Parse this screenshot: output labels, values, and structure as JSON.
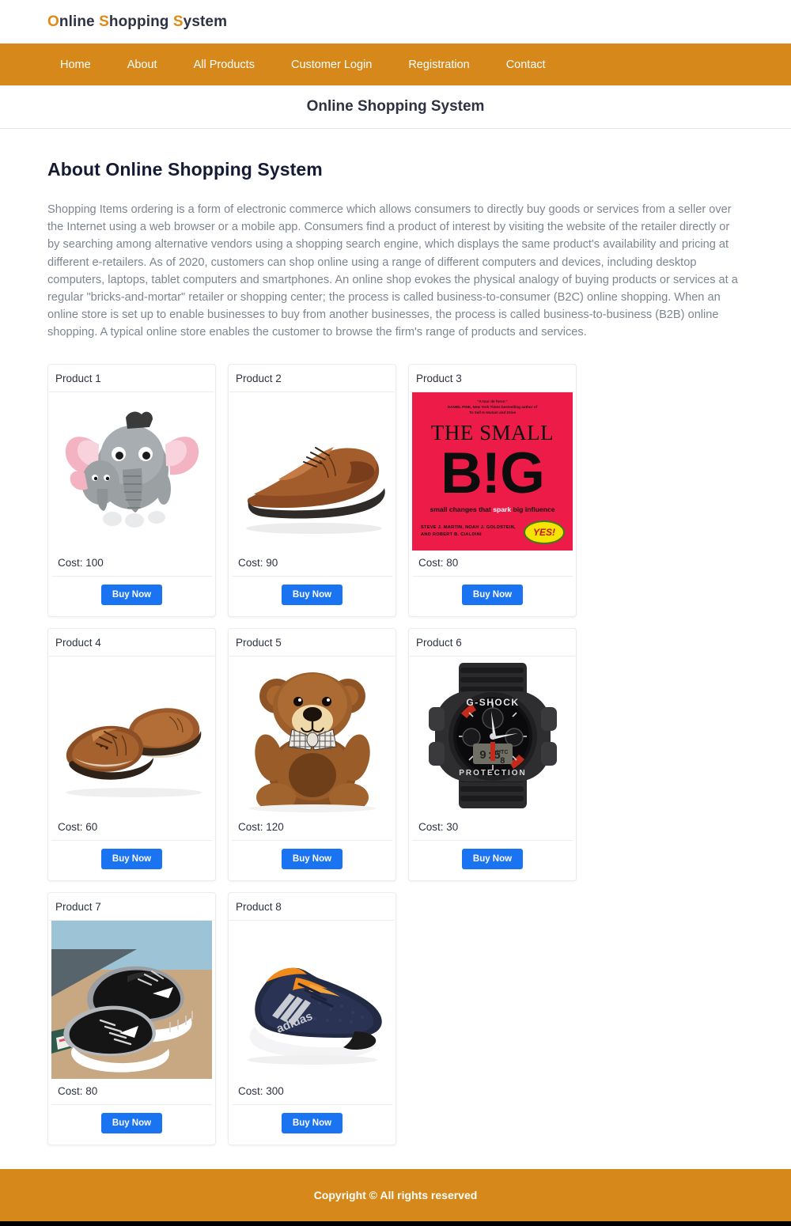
{
  "brand": {
    "parts": [
      {
        "t": "O",
        "hl": true
      },
      {
        "t": "nline ",
        "hl": false
      },
      {
        "t": "S",
        "hl": true
      },
      {
        "t": "hopping ",
        "hl": false
      },
      {
        "t": "S",
        "hl": true
      },
      {
        "t": "ystem",
        "hl": false
      }
    ],
    "full_text": "Online Shopping System"
  },
  "nav": {
    "items": [
      {
        "label": "Home"
      },
      {
        "label": "About"
      },
      {
        "label": "All Products"
      },
      {
        "label": "Customer Login"
      },
      {
        "label": "Registration"
      },
      {
        "label": "Contact"
      }
    ]
  },
  "page": {
    "title": "Online Shopping System",
    "section_title": "About Online Shopping System",
    "about_text": "Shopping Items ordering is a form of electronic commerce which allows consumers to directly buy goods or services from a seller over the Internet using a web browser or a mobile app. Consumers find a product of interest by visiting the website of the retailer directly or by searching among alternative vendors using a shopping search engine, which displays the same product's availability and pricing at different e-retailers. As of 2020, customers can shop online using a range of different computers and devices, including desktop computers, laptops, tablet computers and smartphones. An online shop evokes the physical analogy of buying products or services at a regular \"bricks-and-mortar\" retailer or shopping center; the process is called business-to-consumer (B2C) online shopping. When an online store is set up to enable businesses to buy from another businesses, the process is called business-to-business (B2B) online shopping. A typical online store enables the customer to browse the firm's range of products and services."
  },
  "products": [
    {
      "title": "Product 1",
      "cost": "Cost: 100",
      "buy_label": "Buy Now",
      "image": "elephant-plush-toy-image"
    },
    {
      "title": "Product 2",
      "cost": "Cost: 90",
      "buy_label": "Buy Now",
      "image": "brown-dress-shoe-image"
    },
    {
      "title": "Product 3",
      "cost": "Cost: 80",
      "buy_label": "Buy Now",
      "image": "the-small-big-book-cover-image"
    },
    {
      "title": "Product 4",
      "cost": "Cost: 60",
      "buy_label": "Buy Now",
      "image": "brown-brogue-shoes-pair-image"
    },
    {
      "title": "Product 5",
      "cost": "Cost: 120",
      "buy_label": "Buy Now",
      "image": "brown-teddy-bear-image"
    },
    {
      "title": "Product 6",
      "cost": "Cost: 30",
      "buy_label": "Buy Now",
      "image": "g-shock-watch-image"
    },
    {
      "title": "Product 7",
      "cost": "Cost: 80",
      "buy_label": "Buy Now",
      "image": "black-reebok-sneakers-image"
    },
    {
      "title": "Product 8",
      "cost": "Cost: 300",
      "buy_label": "Buy Now",
      "image": "navy-adidas-sneaker-image"
    }
  ],
  "book_cover": {
    "blurb_quote": "\"A tour de force.\"",
    "blurb_line2": "DANIEL PINK, New York Times bestselling author of",
    "blurb_line3": "To Sell Is Human and Drive",
    "title_top": "THE SMALL",
    "title_big": "B!G",
    "subtitle_a": "small changes that ",
    "subtitle_spark": "spark",
    "subtitle_b": " big influence",
    "authors_line1": "STEVE J. MARTIN, NOAH J. GOLDSTEIN,",
    "authors_line2": "AND ROBERT B. CIALDINI",
    "badge": "YES!"
  },
  "watch": {
    "brand_text": "G-SHOCK",
    "protection_text": "PROTECTION",
    "digital_utc": "UTC"
  },
  "footer": {
    "copyright": "Copyright © All rights reserved"
  },
  "colors": {
    "orange": "#d6891a",
    "brand_highlight": "#e08a13",
    "button_blue": "#1a73f0",
    "text_dark": "#2d3142",
    "body_text": "#7e8591",
    "book_pink": "#ec1b47"
  }
}
